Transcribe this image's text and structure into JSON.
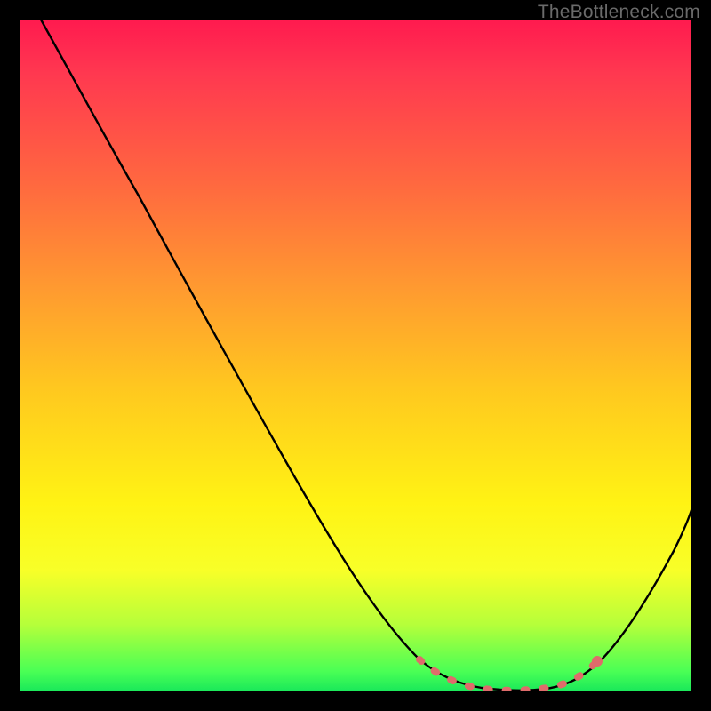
{
  "watermark": "TheBottleneck.com",
  "chart_data": {
    "type": "line",
    "title": "",
    "xlabel": "",
    "ylabel": "",
    "xlim": [
      0,
      100
    ],
    "ylim": [
      0,
      100
    ],
    "grid": false,
    "background_gradient": {
      "stops": [
        {
          "pos": 0,
          "color": "#ff1a4f"
        },
        {
          "pos": 8,
          "color": "#ff3850"
        },
        {
          "pos": 25,
          "color": "#ff6a3f"
        },
        {
          "pos": 40,
          "color": "#ff9a30"
        },
        {
          "pos": 55,
          "color": "#ffc81f"
        },
        {
          "pos": 72,
          "color": "#fff314"
        },
        {
          "pos": 82,
          "color": "#f8ff28"
        },
        {
          "pos": 90,
          "color": "#b6ff3a"
        },
        {
          "pos": 97,
          "color": "#4aff55"
        },
        {
          "pos": 100,
          "color": "#19e85a"
        }
      ]
    },
    "series": [
      {
        "name": "bottleneck-curve",
        "color": "#000000",
        "x": [
          3,
          10,
          18,
          26,
          34,
          42,
          50,
          56,
          60,
          64,
          68,
          72,
          76,
          80,
          84,
          88,
          92,
          96,
          100
        ],
        "y": [
          100,
          90,
          79,
          67,
          55,
          43,
          31,
          20,
          12,
          6,
          2,
          0.5,
          0,
          0.5,
          2,
          7,
          15,
          26,
          41
        ]
      },
      {
        "name": "optimal-region",
        "color": "#e06a6a",
        "x": [
          61,
          64,
          67,
          70,
          73,
          76,
          79,
          82
        ],
        "y": [
          4,
          2,
          1,
          0.5,
          0,
          0.5,
          1.5,
          4
        ]
      }
    ],
    "annotations": []
  }
}
